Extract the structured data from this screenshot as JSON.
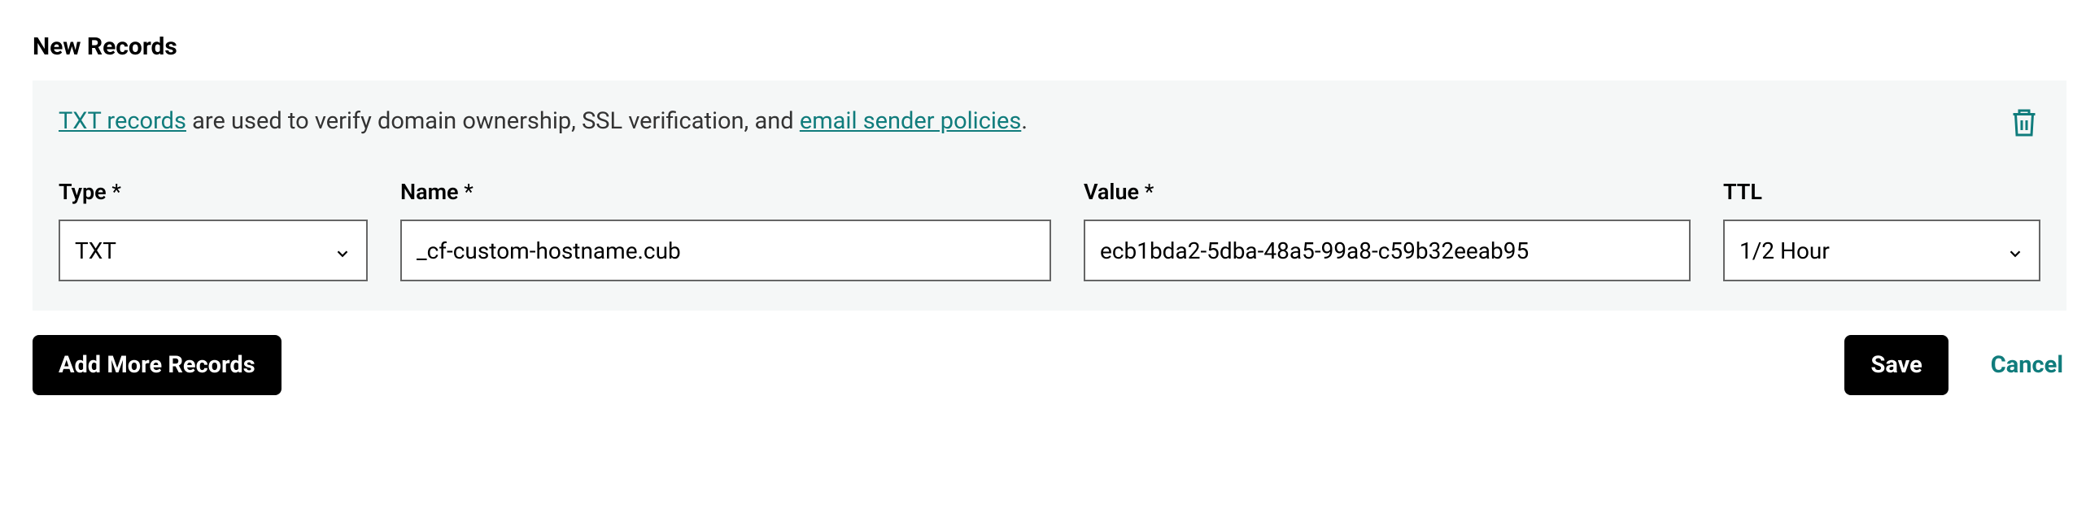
{
  "section_title": "New Records",
  "info": {
    "link1": "TXT records",
    "middle": " are used to verify domain ownership, SSL verification, and ",
    "link2": "email sender policies",
    "after": "."
  },
  "labels": {
    "type": "Type",
    "name": "Name",
    "value": "Value",
    "ttl": "TTL",
    "star": " *"
  },
  "fields": {
    "type_value": "TXT",
    "name_value": "_cf-custom-hostname.cub",
    "value_value": "ecb1bda2-5dba-48a5-99a8-c59b32eeab95",
    "ttl_value": "1/2 Hour"
  },
  "buttons": {
    "add_more": "Add More Records",
    "save": "Save",
    "cancel": "Cancel"
  }
}
